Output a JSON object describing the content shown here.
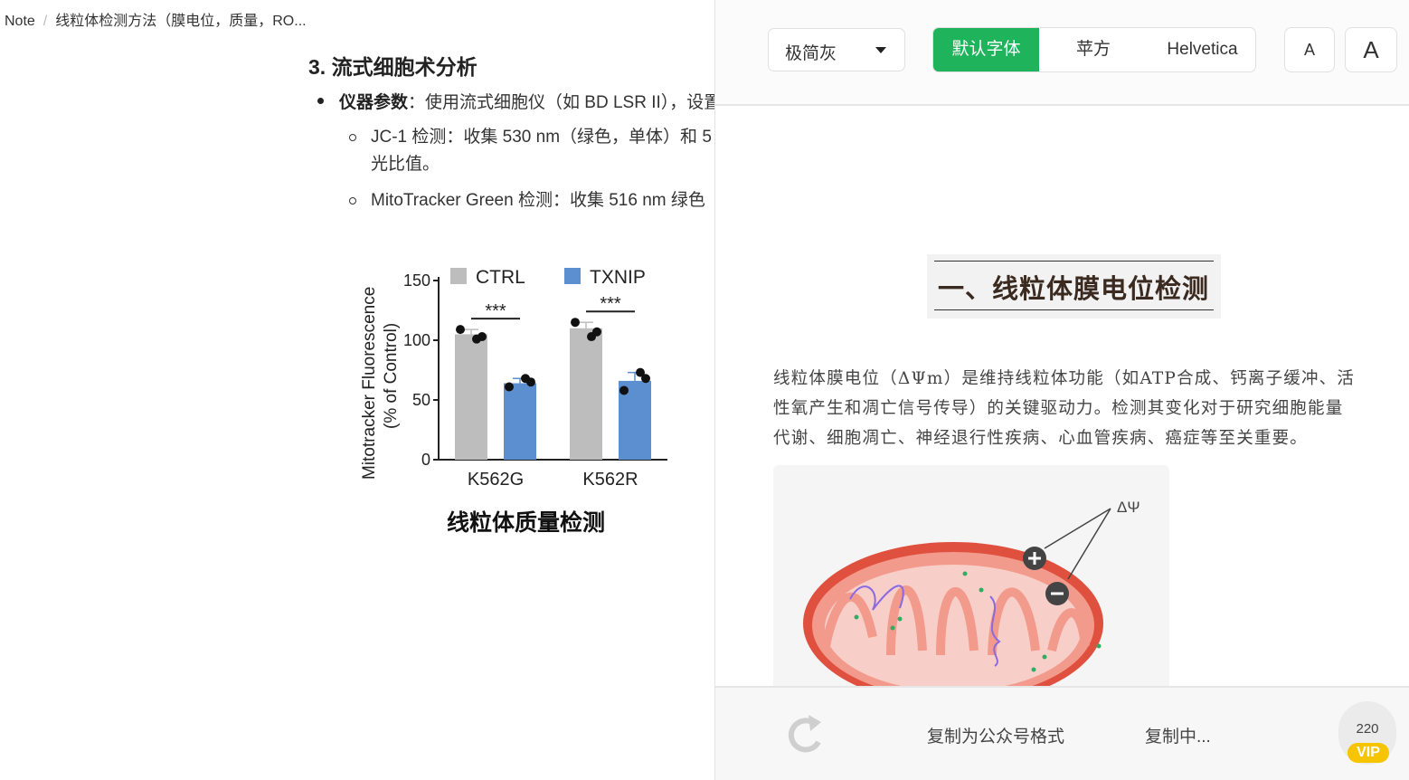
{
  "breadcrumb": {
    "root": "Note",
    "separator": "/",
    "doc": "线粒体检测方法（膜电位，质量，RO..."
  },
  "note": {
    "heading": "3. 流式细胞术分析",
    "bullet_label": "仪器参数",
    "bullet_text": "：使用流式细胞仪（如 BD LSR II），设置",
    "sub1_line1": "JC-1 检测：收集 530 nm（绿色，单体）和 5",
    "sub1_line2": "光比值。",
    "sub2": "MitoTracker Green 检测：收集 516 nm 绿色",
    "caption": "线粒体质量检测"
  },
  "chart_data": {
    "type": "bar",
    "ylabel_line1": "Mitotracker Fluorescence",
    "ylabel_line2": "(% of Control)",
    "categories": [
      "K562G",
      "K562R"
    ],
    "yticks": [
      "0",
      "50",
      "100",
      "150"
    ],
    "ylim": [
      0,
      150
    ],
    "series": [
      {
        "name": "CTRL",
        "color": "#bdbdbd",
        "values": [
          105,
          110
        ],
        "points": [
          [
            109,
            101,
            103
          ],
          [
            115,
            103,
            107
          ]
        ]
      },
      {
        "name": "TXNIP",
        "color": "#5b8fd0",
        "values": [
          64,
          66
        ],
        "points": [
          [
            61,
            68,
            65
          ],
          [
            58,
            73,
            68
          ]
        ]
      }
    ],
    "significance": [
      "***",
      "***"
    ],
    "legend": "top"
  },
  "toolbar": {
    "theme_select": "极简灰",
    "font_options": [
      "默认字体",
      "苹方",
      "Helvetica"
    ],
    "active_font_index": 0,
    "small_a": "A",
    "large_a": "A",
    "accent_color": "#1fb35b"
  },
  "article": {
    "title": "一、线粒体膜电位检测",
    "para_lines": [
      "线粒体膜电位（ΔΨm）是维持线粒体功能（如ATP合成、钙离子缓冲、活",
      "性氧产生和凋亡信号传导）的关键驱动力。检测其变化对于研究细胞能量",
      "代谢、细胞凋亡、神经退行性疾病、心血管疾病、癌症等至关重要。"
    ],
    "illustration_label": "ΔΨ"
  },
  "footer": {
    "copy_format": "复制为公众号格式",
    "copying": "复制中...",
    "count": "220",
    "vip": "VIP"
  }
}
